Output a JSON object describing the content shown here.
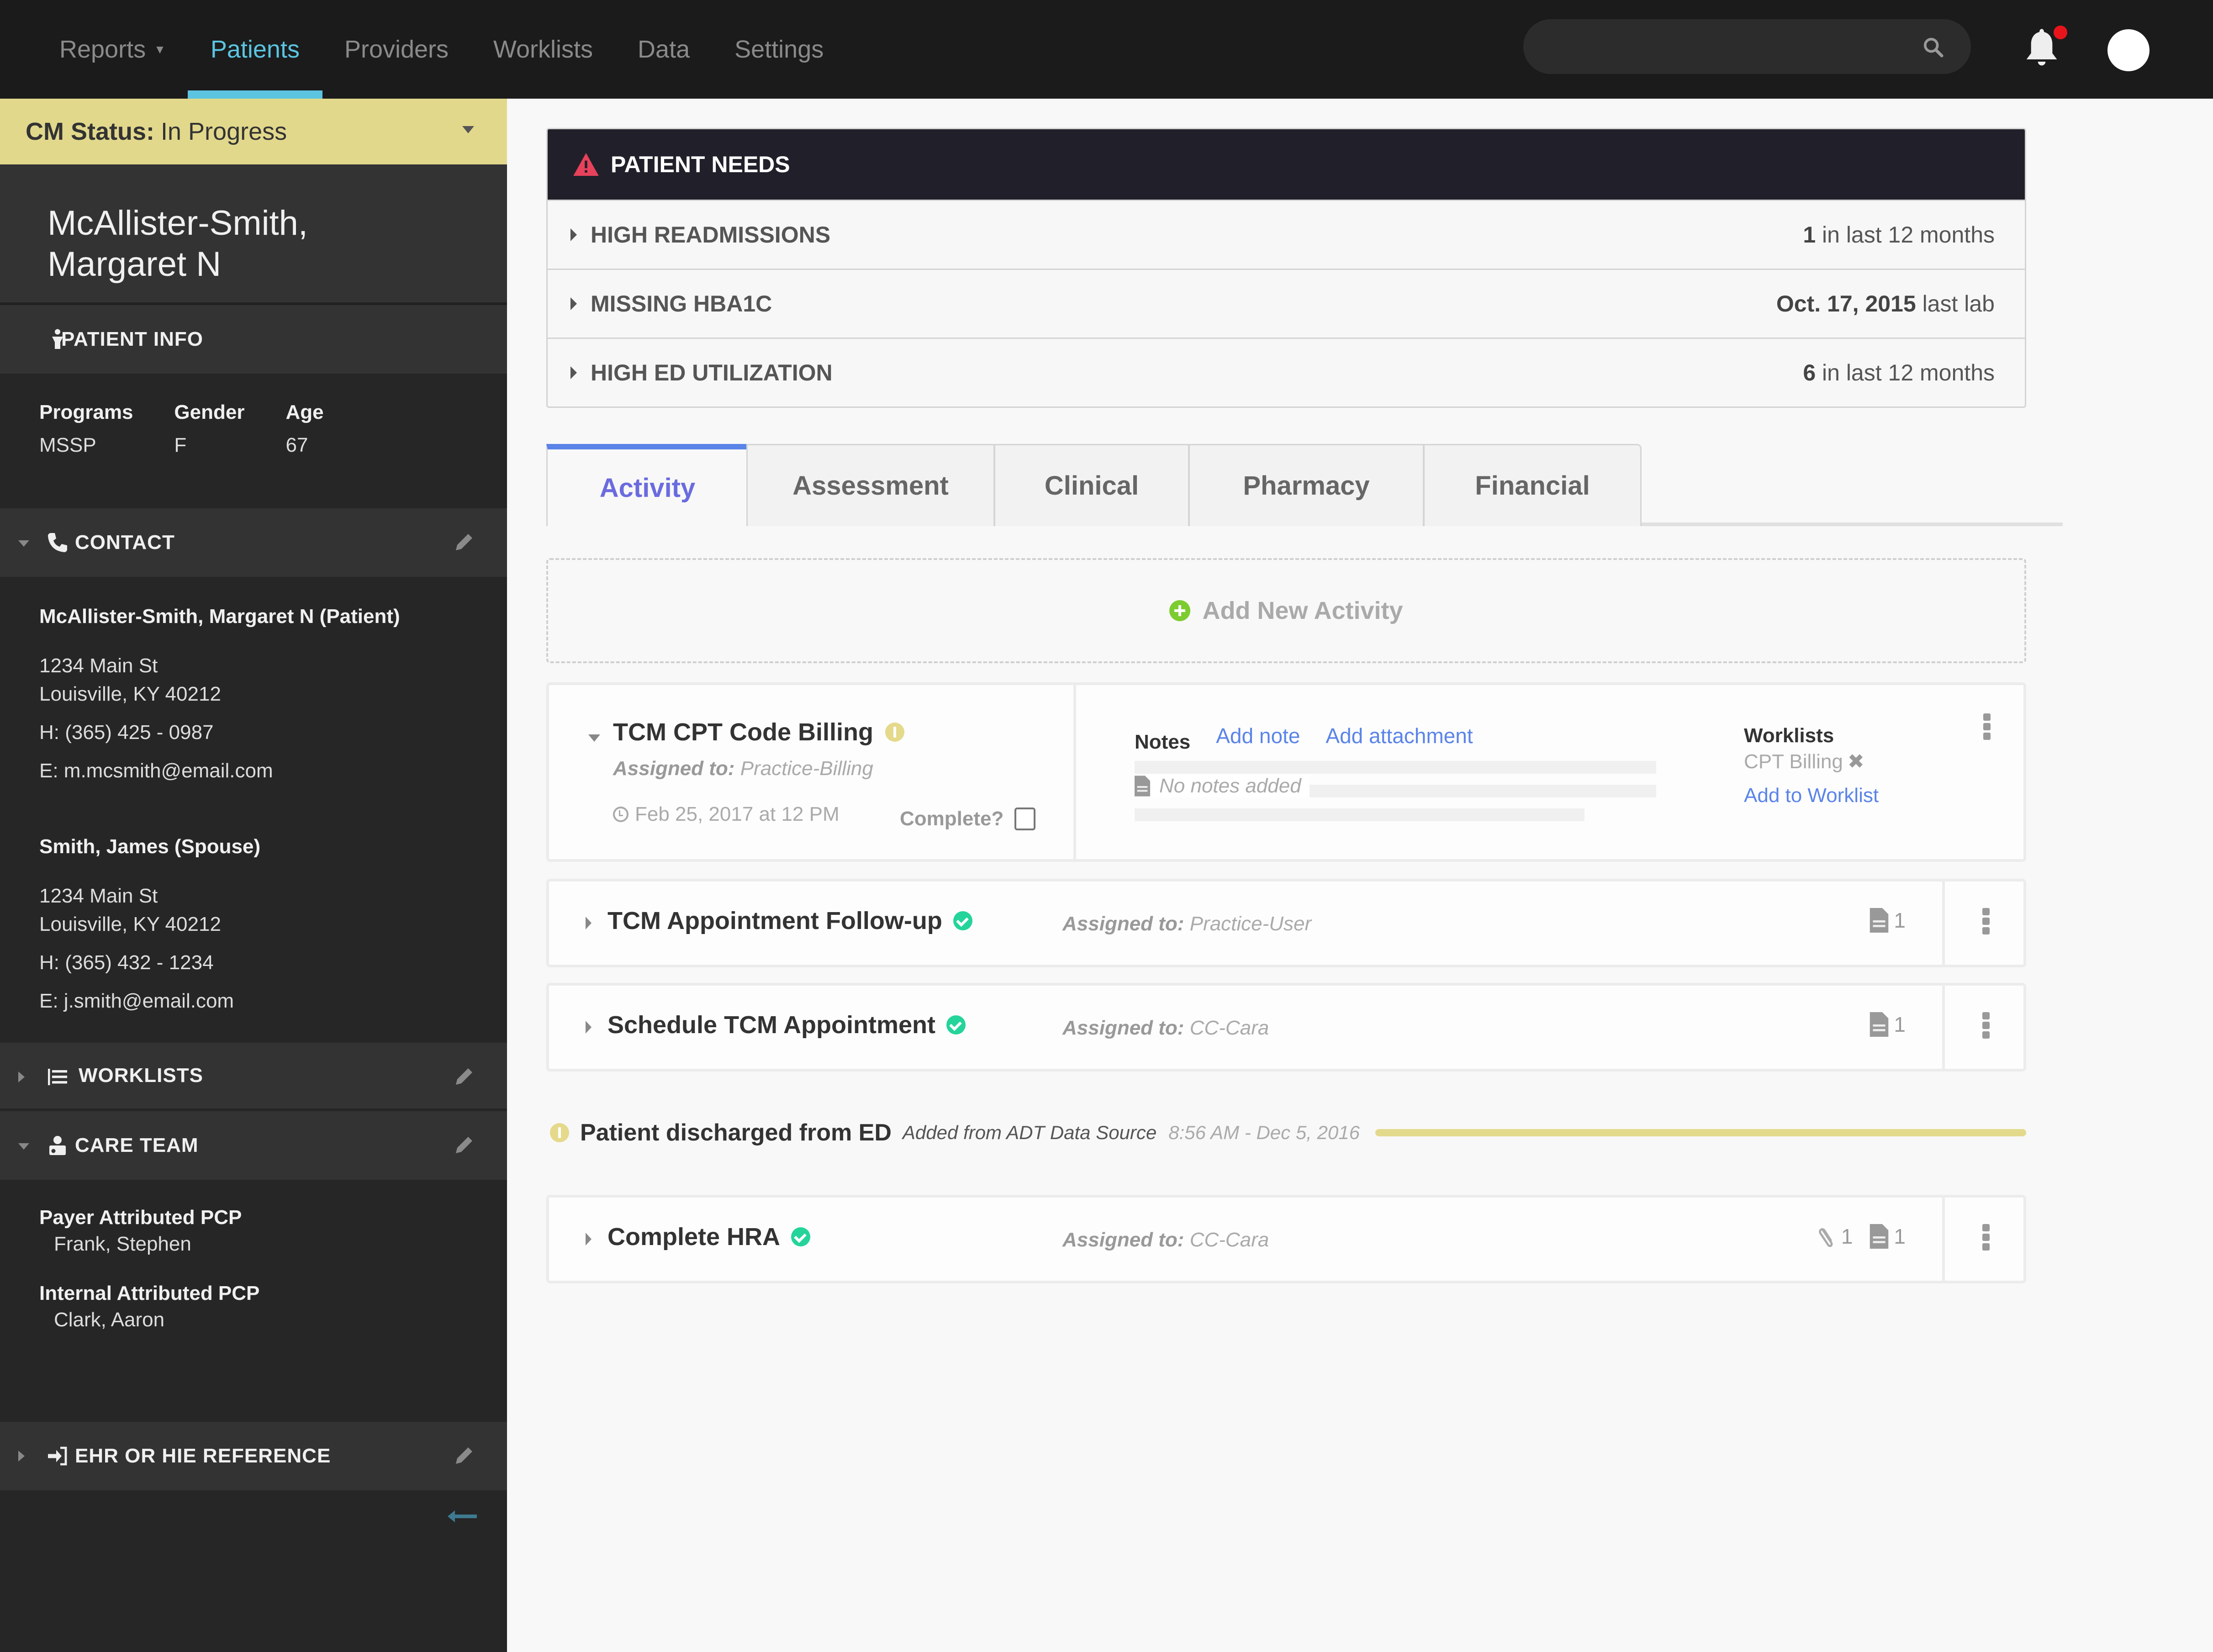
{
  "nav": {
    "items": [
      {
        "label": "Reports",
        "has_caret": true,
        "active": false
      },
      {
        "label": "Patients",
        "active": true
      },
      {
        "label": "Providers",
        "active": false
      },
      {
        "label": "Worklists",
        "active": false
      },
      {
        "label": "Data",
        "active": false
      },
      {
        "label": "Settings",
        "active": false
      }
    ],
    "search_placeholder": "",
    "notification_dot_color": "#e8141c",
    "accent_color": "#5bc4e0"
  },
  "sidebar": {
    "cm_status": {
      "label": "CM Status:",
      "value": "In Progress"
    },
    "patient_name_line1": "McAllister-Smith,",
    "patient_name_line2": "Margaret N",
    "patient_info": {
      "title": "PATIENT INFO",
      "fields": [
        {
          "label": "Programs",
          "value": "MSSP"
        },
        {
          "label": "Gender",
          "value": "F"
        },
        {
          "label": "Age",
          "value": "67"
        }
      ]
    },
    "contact": {
      "title": "CONTACT",
      "people": [
        {
          "name": "McAllister-Smith, Margaret N (Patient)",
          "address1": "1234 Main St",
          "address2": "Louisville, KY 40212",
          "phone": "H: (365) 425 - 0987",
          "email": "E: m.mcsmith@email.com"
        },
        {
          "name": "Smith, James (Spouse)",
          "address1": "1234 Main St",
          "address2": "Louisville, KY 40212",
          "phone": "H: (365) 432 - 1234",
          "email": "E: j.smith@email.com"
        }
      ]
    },
    "worklists": {
      "title": "WORKLISTS"
    },
    "care_team": {
      "title": "CARE TEAM",
      "members": [
        {
          "role": "Payer Attributed PCP",
          "name": "Frank, Stephen"
        },
        {
          "role": "Internal Attributed PCP",
          "name": "Clark, Aaron"
        }
      ]
    },
    "ehr": {
      "title": "EHR OR HIE REFERENCE"
    }
  },
  "patient_needs": {
    "title": "PATIENT NEEDS",
    "rows": [
      {
        "label": "HIGH READMISSIONS",
        "value_bold": "1",
        "value_rest": " in last 12 months"
      },
      {
        "label": "MISSING HBA1C",
        "value_bold": "Oct. 17, 2015",
        "value_rest": " last lab"
      },
      {
        "label": "HIGH ED UTILIZATION",
        "value_bold": "6",
        "value_rest": " in last 12 months"
      }
    ]
  },
  "tabs": [
    {
      "label": "Activity",
      "active": true
    },
    {
      "label": "Assessment",
      "active": false
    },
    {
      "label": "Clinical",
      "active": false
    },
    {
      "label": "Pharmacy",
      "active": false
    },
    {
      "label": "Financial",
      "active": false
    }
  ],
  "add_activity_label": "Add New Activity",
  "activities": {
    "expanded": {
      "title": "TCM CPT Code Billing",
      "status": "warning",
      "assigned_label": "Assigned to:",
      "assigned_to": "Practice-Billing",
      "date": "Feb 25, 2017 at 12 PM",
      "complete_label": "Complete?",
      "complete_checked": false,
      "notes_label": "Notes",
      "add_note": "Add note",
      "add_attachment": "Add attachment",
      "no_notes": "No notes added",
      "worklists_label": "Worklists",
      "worklist_item": "CPT Billing",
      "add_to_worklist": "Add to Worklist"
    },
    "rows": [
      {
        "title": "TCM Appointment Follow-up",
        "status": "complete",
        "assigned_label": "Assigned to:",
        "assigned_to": "Practice-User",
        "attachments": null,
        "notes": "1"
      },
      {
        "title": "Schedule TCM Appointment",
        "status": "complete",
        "assigned_label": "Assigned to:",
        "assigned_to": "CC-Cara",
        "attachments": null,
        "notes": "1"
      }
    ],
    "event": {
      "title": "Patient discharged from ED",
      "source": "Added from ADT Data Source",
      "time": "8:56 AM - Dec 5, 2016"
    },
    "last_row": {
      "title": "Complete HRA",
      "status": "complete",
      "assigned_label": "Assigned to:",
      "assigned_to": "CC-Cara",
      "attachments": "1",
      "notes": "1"
    }
  }
}
